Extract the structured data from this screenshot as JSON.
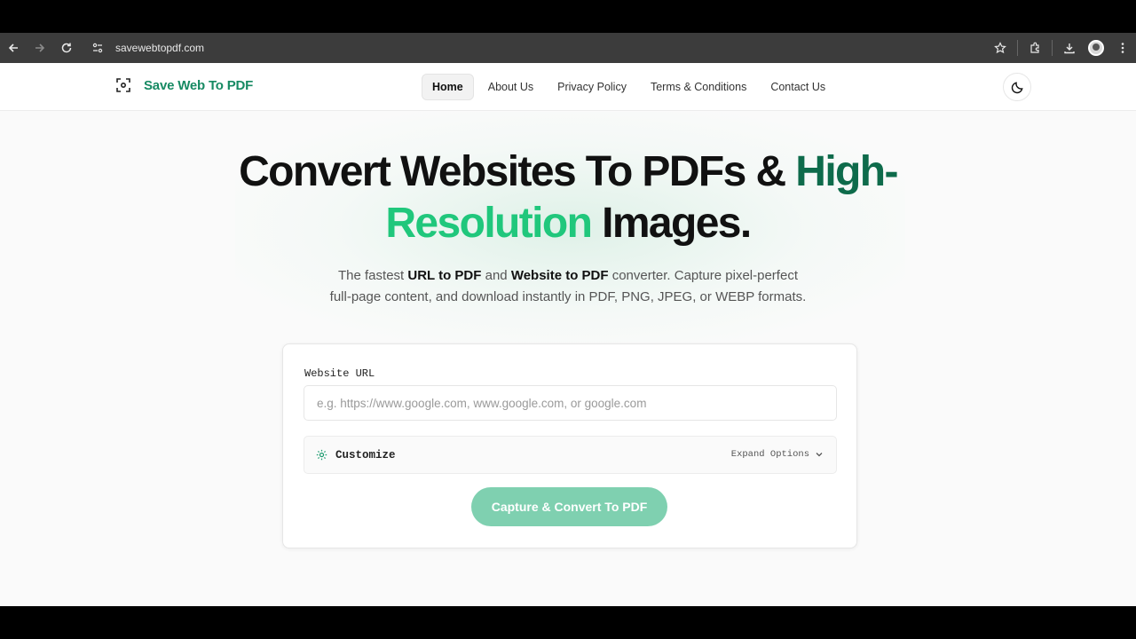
{
  "browser": {
    "url": "savewebtopdf.com"
  },
  "header": {
    "brand": "Save Web To PDF",
    "menu": [
      {
        "label": "Home",
        "active": true
      },
      {
        "label": "About Us"
      },
      {
        "label": "Privacy Policy"
      },
      {
        "label": "Terms & Conditions"
      },
      {
        "label": "Contact Us"
      }
    ],
    "theme_icon": "moon-icon"
  },
  "hero": {
    "title_part1": "Convert Websites To PDFs & ",
    "title_highlight1": "High-",
    "title_highlight2": "Resolution",
    "title_part2": " Images.",
    "sub_a": "The fastest ",
    "sub_b": "URL to PDF",
    "sub_c": " and ",
    "sub_d": "Website to PDF",
    "sub_e": " converter. Capture pixel-perfect",
    "sub_f": "full-page content, and download instantly in PDF, PNG, JPEG, or WEBP formats."
  },
  "form": {
    "label": "Website URL",
    "placeholder": "e.g. https://www.google.com, www.google.com, or google.com",
    "value": "",
    "customize_label": "Customize",
    "expand_label": "Expand Options",
    "submit_label": "Capture & Convert To PDF"
  },
  "colors": {
    "brand_green": "#178a63",
    "title_dark_green": "#0e6b4b",
    "title_bright_green": "#20c77c",
    "button_bg": "#7fd0b0"
  }
}
